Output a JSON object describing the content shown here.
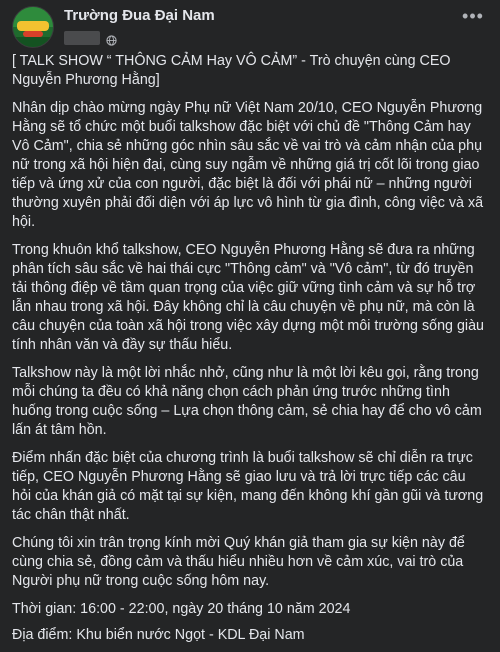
{
  "page": {
    "name": "Trường Đua Đại Nam"
  },
  "post": {
    "paragraphs": [
      "[ TALK SHOW “ THÔNG CẢM Hay VÔ CẢM” - Trò chuyện cùng CEO Nguyễn Phương Hằng]",
      "Nhân dịp chào mừng ngày Phụ nữ Việt Nam 20/10, CEO Nguyễn Phương Hằng sẽ tổ chức một buổi talkshow đặc biệt với chủ đề \"Thông Cảm hay Vô Cảm\", chia sẻ những góc nhìn sâu sắc về vai trò và cảm nhận của phụ nữ trong xã hội hiện đại, cùng suy ngẫm về những giá trị cốt lõi trong giao tiếp và ứng xử của con người, đặc biệt là đối với phái nữ – những người thường xuyên phải đối diện với áp lực vô hình từ gia đình, công việc và xã hội.",
      "Trong khuôn khổ talkshow, CEO Nguyễn Phương Hằng sẽ đưa ra những phân tích sâu sắc về hai thái cực \"Thông cảm\" và \"Vô cảm\", từ đó truyền tải thông điệp về tầm quan trọng của việc giữ vững tình cảm và sự hỗ trợ lẫn nhau trong xã hội. Đây không chỉ là câu chuyện về phụ nữ, mà còn là câu chuyện của toàn xã hội trong việc xây dựng một môi trường sống giàu tính nhân văn và đầy sự thấu hiểu.",
      "Talkshow này là một lời nhắc nhở, cũng như là một lời kêu gọi, rằng trong mỗi chúng ta đều có khả năng chọn cách phản ứng trước những tình huống trong cuộc sống – Lựa chọn thông cảm, sẻ chia hay để cho vô cảm lấn át tâm hồn.",
      "Điểm nhấn đặc biệt của chương trình là buổi talkshow sẽ chỉ diễn ra trực tiếp, CEO Nguyễn Phương Hằng sẽ giao lưu và trả lời trực tiếp các câu hỏi của khán giả có mặt tại sự kiện, mang đến không khí gần gũi và tương tác chân thật nhất.",
      "Chúng tôi xin trân trọng kính mời Quý khán giả tham gia sự kiện này để cùng chia sẻ, đồng cảm và thấu hiểu nhiều hơn về cảm xúc, vai trò của Người phụ nữ trong cuộc sống hôm nay.",
      "Thời gian: 16:00 - 22:00, ngày 20 tháng 10 năm 2024",
      "Địa điểm: Khu biển nước Ngọt - KDL Đại Nam"
    ]
  },
  "icons": {
    "more": "more-horizontal-icon",
    "privacy": "globe-icon"
  },
  "colors": {
    "background": "#242526",
    "text": "#e4e6eb",
    "muted": "#b0b3b8"
  }
}
